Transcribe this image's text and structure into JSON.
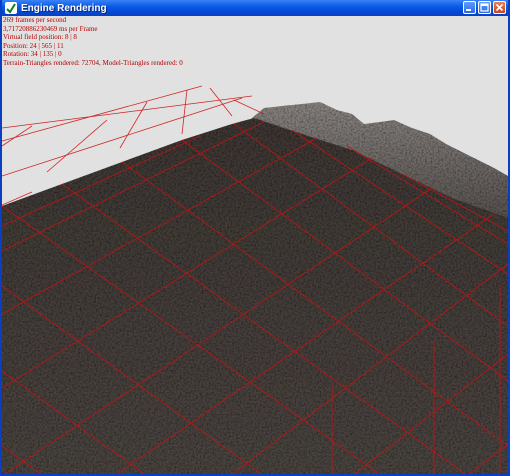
{
  "window": {
    "title": "Engine Rendering",
    "accent": "#0a5ce8",
    "close_color": "#c8451c"
  },
  "hud": {
    "lines": [
      "269 frames per second",
      "3,71720886230469 ms per Frame",
      "Virtual field position: 8 | 8",
      "Position: 24 | 565 | 11",
      "Rotation: 34 | 135 | 0",
      "Terrain-Triangles rendered: 72704, Model-Triangles rendered: 0"
    ],
    "color": "#b40000"
  },
  "scene": {
    "sky_color": "#e1e1e1",
    "terrain_color": "#3a3532",
    "grid_color": "#cc1010"
  }
}
